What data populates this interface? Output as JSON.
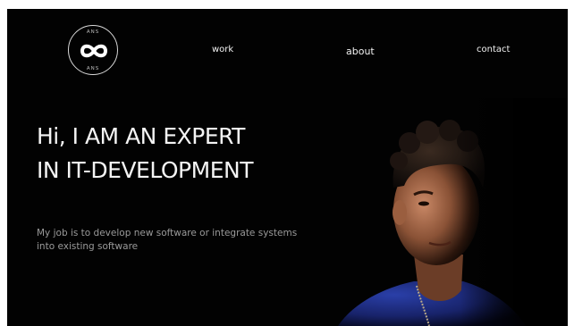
{
  "logo": {
    "top_text": "ANS",
    "bottom_text": "ANS",
    "icon": "infinity-icon"
  },
  "nav": {
    "items": [
      {
        "label": "work"
      },
      {
        "label": "about"
      },
      {
        "label": "contact"
      }
    ]
  },
  "hero": {
    "headline_line1": "Hi, I AM AN EXPERT",
    "headline_line2": "IN IT-DEVELOPMENT",
    "subtitle": "My job is to develop new software or integrate systems into existing software"
  },
  "colors": {
    "background": "#020202",
    "text": "#f4f4f4",
    "subtitle": "#9a9a9a",
    "shirt": "#1f2f8a"
  }
}
